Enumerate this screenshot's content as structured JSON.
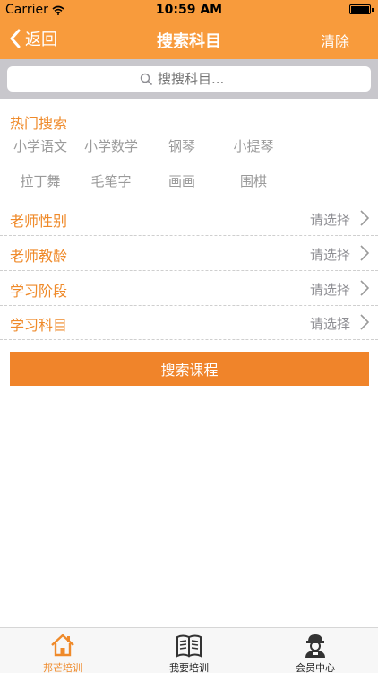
{
  "status_bar": {
    "carrier": "Carrier",
    "time": "10:59 AM"
  },
  "nav": {
    "back_label": "返回",
    "title": "搜索科目",
    "clear_label": "清除"
  },
  "search": {
    "placeholder": "搜搜科目..."
  },
  "hot_search": {
    "title": "热门搜索",
    "tags": [
      "小学语文",
      "小学数学",
      "钢琴",
      "小提琴",
      "拉丁舞",
      "毛笔字",
      "画画",
      "围棋"
    ]
  },
  "filters": [
    {
      "label": "老师性别",
      "value": "请选择"
    },
    {
      "label": "老师教龄",
      "value": "请选择"
    },
    {
      "label": "学习阶段",
      "value": "请选择"
    },
    {
      "label": "学习科目",
      "value": "请选择"
    }
  ],
  "search_button": {
    "label": "搜索课程"
  },
  "tab_bar": [
    {
      "label": "邦芒培训",
      "icon": "home-icon",
      "active": true
    },
    {
      "label": "我要培训",
      "icon": "book-icon",
      "active": false
    },
    {
      "label": "会员中心",
      "icon": "member-icon",
      "active": false
    }
  ],
  "colors": {
    "accent": "#f89b3c",
    "button": "#f0842a",
    "label": "#ef8a2a"
  }
}
